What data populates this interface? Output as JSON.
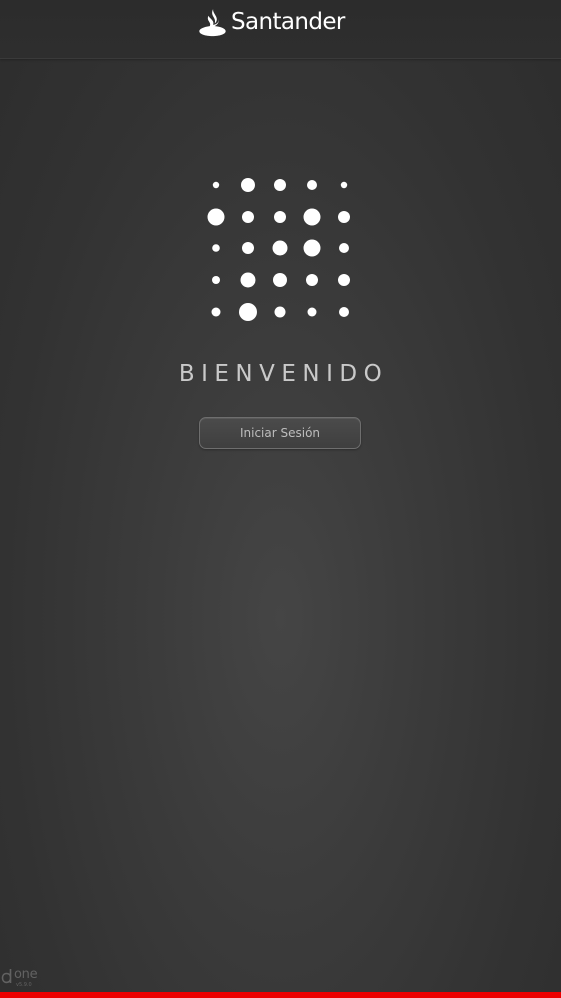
{
  "header": {
    "brand_name": "Santander",
    "brand_icon": "flame-icon"
  },
  "main": {
    "logo_icon": "dots-grid-icon",
    "welcome_text": "BIENVENIDO",
    "login_button_label": "Iniciar Sesión"
  },
  "footer": {
    "logo_name": "one",
    "version": "v5.9.0"
  },
  "colors": {
    "brand_red": "#ec0000",
    "background": "#3b3b3b",
    "header_background": "#2c2c2c",
    "text_light": "#c9c9c9"
  }
}
